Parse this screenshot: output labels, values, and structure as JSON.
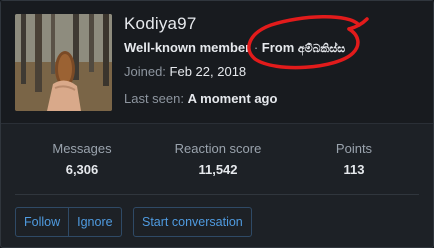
{
  "profile": {
    "username": "Kodiya97",
    "title": "Well-known member",
    "separator": "·",
    "from_label": "From",
    "location": "අම්බකිස්ස",
    "joined_label": "Joined:",
    "joined_value": "Feb 22, 2018",
    "lastseen_label": "Last seen:",
    "lastseen_value": "A moment ago",
    "avatar_icon": "user-avatar-photo"
  },
  "stats": [
    {
      "label": "Messages",
      "value": "6,306"
    },
    {
      "label": "Reaction score",
      "value": "11,542"
    },
    {
      "label": "Points",
      "value": "113"
    }
  ],
  "actions": {
    "follow": "Follow",
    "ignore": "Ignore",
    "start_conversation": "Start conversation"
  },
  "colors": {
    "background": "#1d2126",
    "header": "#181b1f",
    "link": "#4f9be0",
    "annotation": "#e21b1b"
  }
}
